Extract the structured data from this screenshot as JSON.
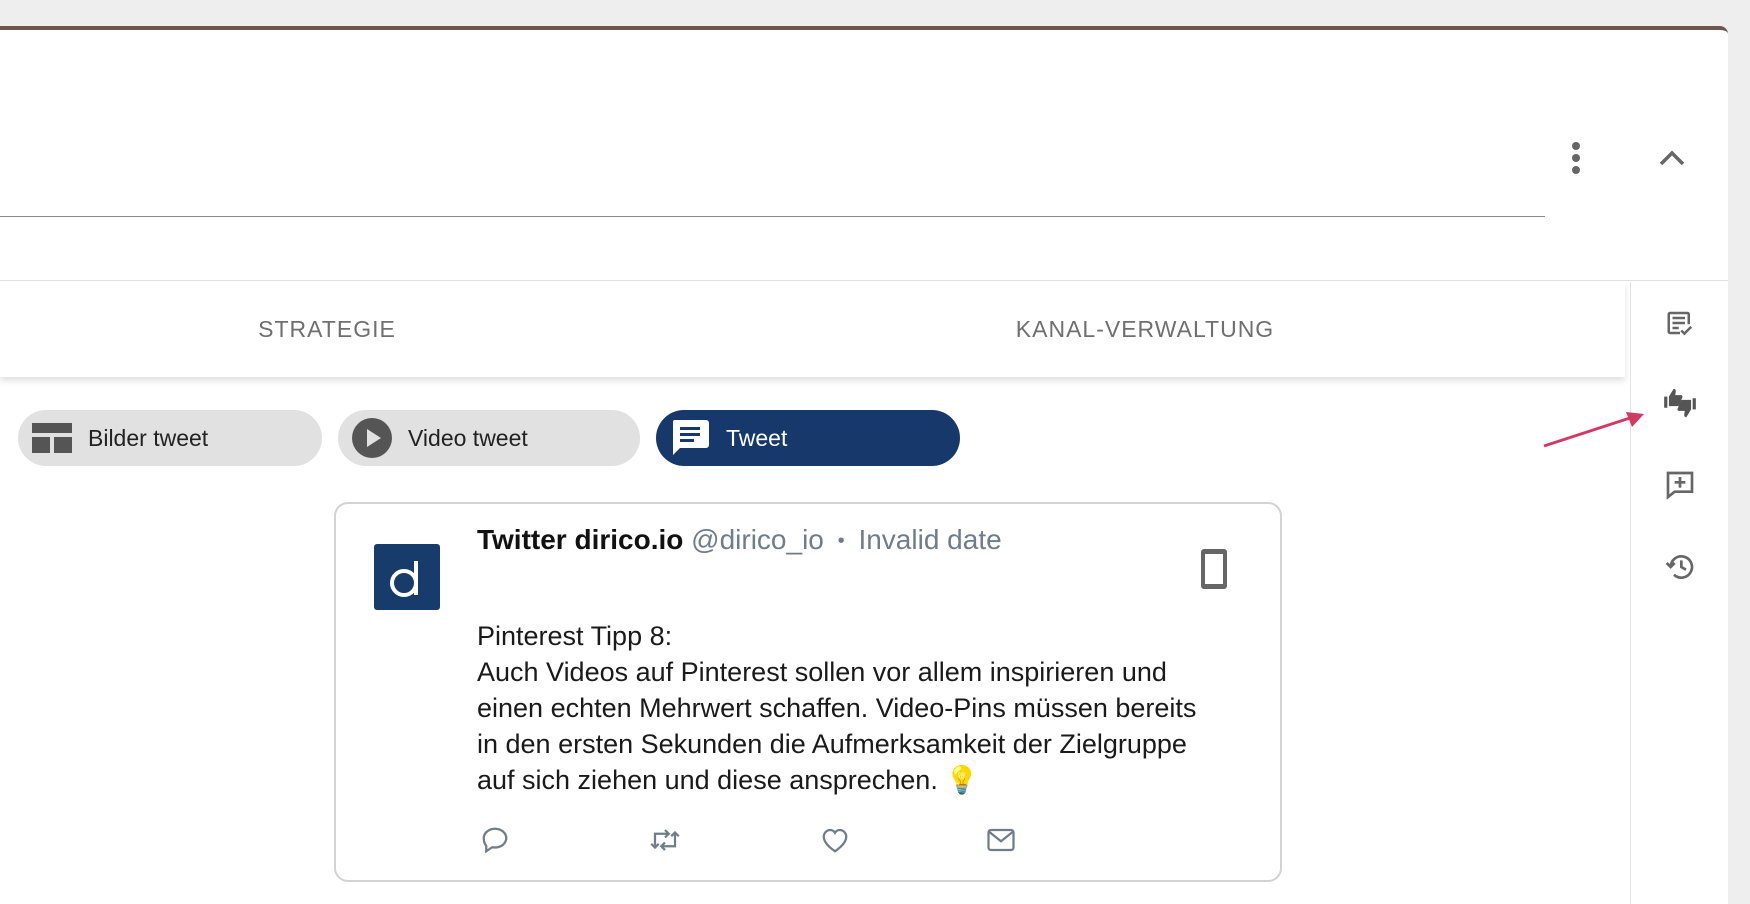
{
  "tabs": [
    {
      "label": "STRATEGIE"
    },
    {
      "label": "KANAL-VERWALTUNG"
    }
  ],
  "chips": [
    {
      "label": "Bilder tweet",
      "icon": "gallery-icon",
      "selected": false
    },
    {
      "label": "Video tweet",
      "icon": "play-icon",
      "selected": false
    },
    {
      "label": "Tweet",
      "icon": "message-icon",
      "selected": true
    }
  ],
  "tweet": {
    "avatar_letter": "d",
    "name": "Twitter dirico.io",
    "handle": "@dirico_io",
    "separator": "•",
    "date": "Invalid date",
    "text_lines": [
      "Pinterest Tipp 8:",
      "Auch Videos auf Pinterest sollen vor allem inspirieren und",
      "einen echten Mehrwert schaffen. Video-Pins müssen bereits",
      "in den ersten Sekunden die Aufmerksamkeit der Zielgruppe",
      "auf sich ziehen und diese ansprechen. 💡"
    ]
  },
  "side_rail": [
    "checklist-icon",
    "thumbs-up-down-icon",
    "add-comment-icon",
    "history-icon"
  ],
  "colors": {
    "accent": "#16386b",
    "header_border": "#6d5650",
    "annotation_arrow": "#d23a63"
  }
}
